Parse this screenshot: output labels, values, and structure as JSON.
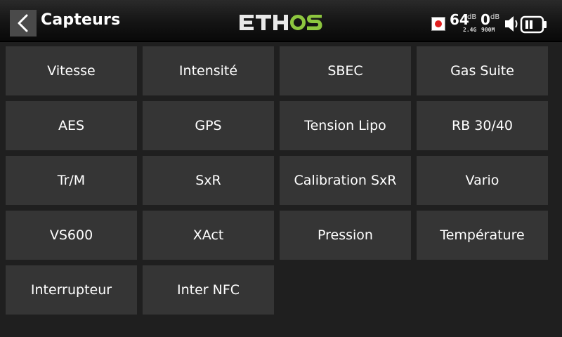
{
  "header": {
    "back_icon": "chevron-left-icon",
    "title": "Capteurs",
    "logo": "ETHOS",
    "logo_colors": {
      "eth": "#e8e8e8",
      "os": "#8dc63f"
    }
  },
  "status": {
    "record_icon": "record-icon",
    "record_color": "#e02020",
    "rssi_1": "64",
    "rssi_1_unit": "dB",
    "rssi_2": "0",
    "rssi_2_unit": "dB",
    "band_1": "2.4G",
    "band_2": "900M",
    "speaker_icon": "speaker-icon",
    "battery_icon": "battery-icon"
  },
  "sensors": [
    {
      "label": "Vitesse"
    },
    {
      "label": "Intensité"
    },
    {
      "label": "SBEC"
    },
    {
      "label": "Gas Suite"
    },
    {
      "label": "AES"
    },
    {
      "label": "GPS"
    },
    {
      "label": "Tension Lipo"
    },
    {
      "label": "RB 30/40"
    },
    {
      "label": "Tr/M"
    },
    {
      "label": "SxR"
    },
    {
      "label": "Calibration SxR"
    },
    {
      "label": "Vario"
    },
    {
      "label": "VS600"
    },
    {
      "label": "XAct"
    },
    {
      "label": "Pression"
    },
    {
      "label": "Température"
    },
    {
      "label": "Interrupteur"
    },
    {
      "label": "Inter NFC"
    }
  ],
  "colors": {
    "background": "#1f1f1f",
    "tile": "#353535",
    "text": "#ffffff"
  }
}
